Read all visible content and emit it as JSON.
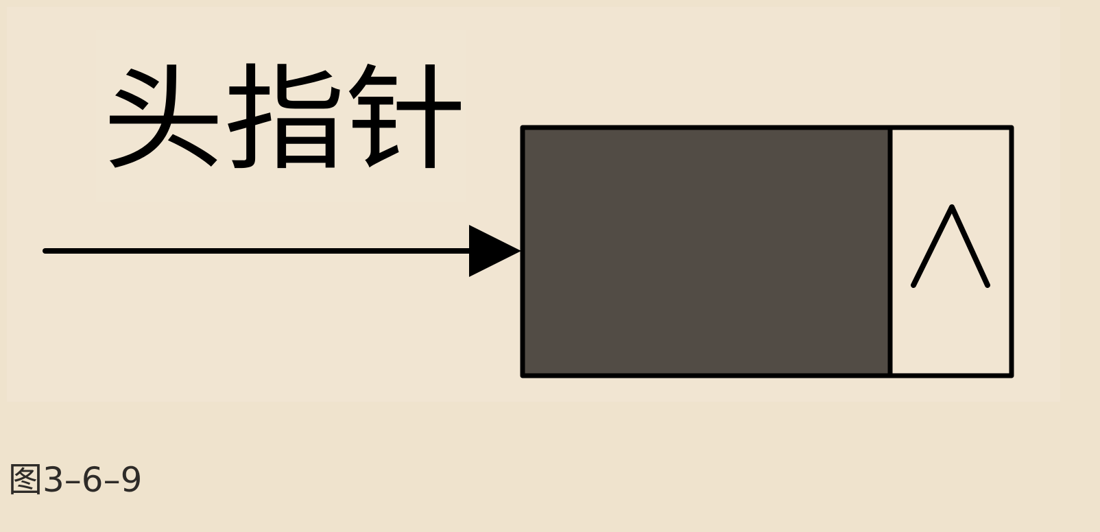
{
  "diagram": {
    "head_pointer_label": "头指针",
    "null_pointer_symbol": "^",
    "colors": {
      "background": "#efe3cd",
      "panel": "#f1e5d2",
      "data_field": "#524c45",
      "pointer_field": "#f1e5d2",
      "stroke": "#000000"
    }
  },
  "caption": {
    "text": "图3–6–9"
  }
}
